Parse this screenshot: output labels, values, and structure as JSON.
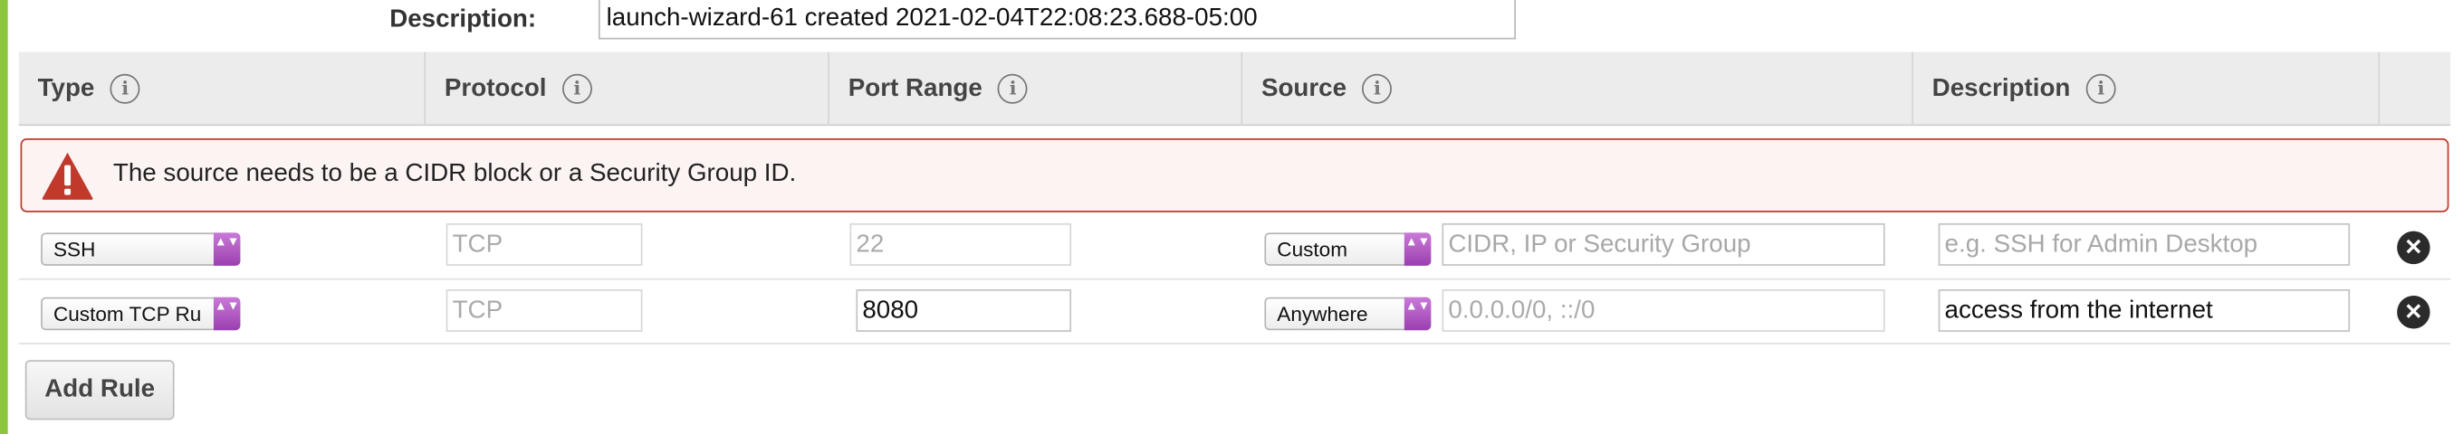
{
  "description": {
    "label": "Description:",
    "value": "launch-wizard-61 created 2021-02-04T22:08:23.688-05:00"
  },
  "table": {
    "columns": [
      {
        "label": "Type"
      },
      {
        "label": "Protocol"
      },
      {
        "label": "Port Range"
      },
      {
        "label": "Source"
      },
      {
        "label": "Description"
      }
    ],
    "info_glyph": "i"
  },
  "error": {
    "message": "The source needs to be a CIDR block or a Security Group ID.",
    "icon": "warning-triangle-icon",
    "color": "#c0392b"
  },
  "rules": [
    {
      "type": "SSH",
      "protocol": "TCP",
      "port_range": "22",
      "source_mode": "Custom",
      "source_value": "",
      "source_placeholder": "CIDR, IP or Security Group",
      "description": "",
      "description_placeholder": "e.g. SSH for Admin Desktop"
    },
    {
      "type": "Custom TCP Ru",
      "protocol": "TCP",
      "port_range": "8080",
      "source_mode": "Anywhere",
      "source_value": "0.0.0.0/0, ::/0",
      "source_placeholder": "",
      "description": "access from the internet",
      "description_placeholder": ""
    }
  ],
  "remove_glyph": "✕",
  "select_arrows": "▲▼",
  "add_rule_label": "Add Rule",
  "colors": {
    "accent": "#8cc63f",
    "select_arrow": "#9b3fb0",
    "error_border": "#c0392b",
    "error_bg": "#fcf3f3"
  }
}
